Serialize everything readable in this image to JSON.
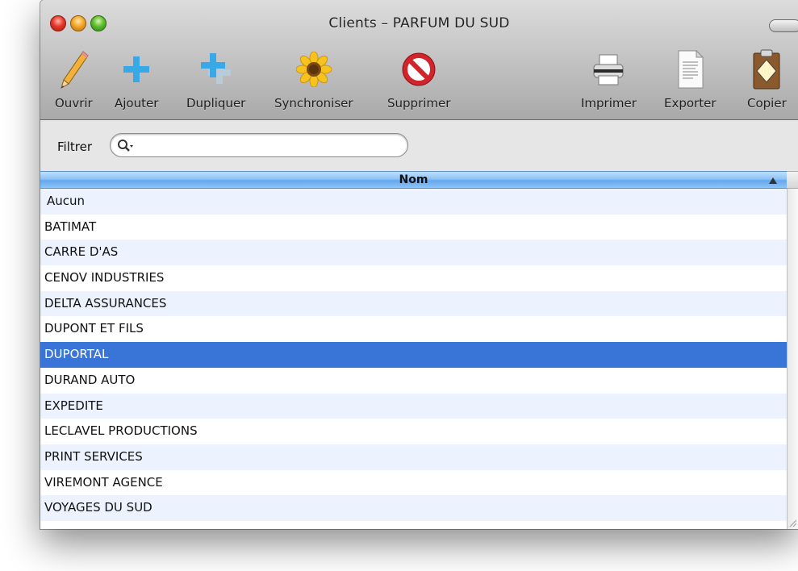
{
  "window": {
    "title": "Clients – PARFUM DU SUD"
  },
  "toolbar": {
    "items": [
      {
        "label": "Ouvrir",
        "icon": "pencil-icon"
      },
      {
        "label": "Ajouter",
        "icon": "plus-icon"
      },
      {
        "label": "Dupliquer",
        "icon": "duplicate-icon"
      },
      {
        "label": "Synchroniser",
        "icon": "sunflower-icon"
      },
      {
        "label": "Supprimer",
        "icon": "prohibited-icon"
      },
      {
        "label": "Imprimer",
        "icon": "printer-icon"
      },
      {
        "label": "Exporter",
        "icon": "document-icon"
      },
      {
        "label": "Copier",
        "icon": "clipboard-icon"
      }
    ]
  },
  "filter": {
    "label": "Filtrer",
    "value": ""
  },
  "table": {
    "column_header": "Nom",
    "sort": "ascending",
    "selected_index": 6,
    "rows": [
      "Aucun",
      "BATIMAT",
      "CARRE D'AS",
      "CENOV INDUSTRIES",
      "DELTA ASSURANCES",
      "DUPONT ET FILS",
      "DUPORTAL",
      "DURAND AUTO",
      "EXPEDITE",
      "LECLAVEL PRODUCTIONS",
      "PRINT SERVICES",
      "VIREMONT AGENCE",
      "VOYAGES DU SUD"
    ]
  },
  "colors": {
    "selection": "#3875d7",
    "alternate_row": "#edf3fe",
    "header_blue": "#8cc3f6"
  }
}
